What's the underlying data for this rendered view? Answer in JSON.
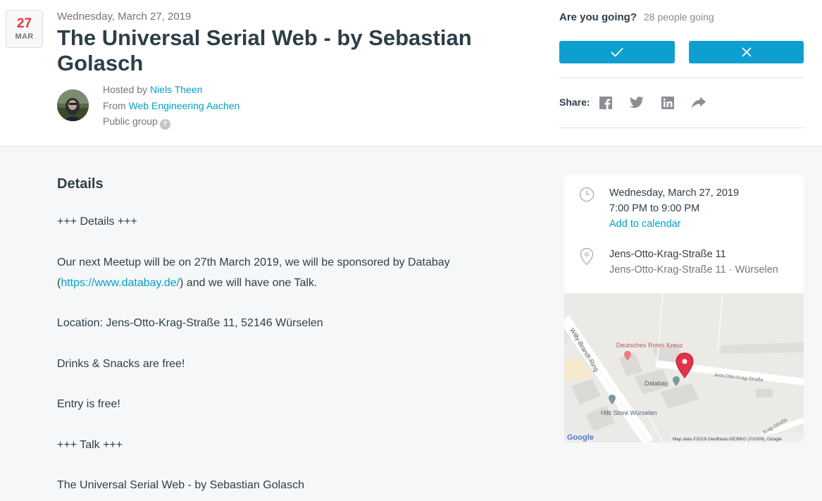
{
  "event": {
    "day": "27",
    "month": "MAR",
    "date_full": "Wednesday, March 27, 2019",
    "title": "The Universal Serial Web - by Sebastian Golasch"
  },
  "host": {
    "hosted_by_prefix": "Hosted by",
    "host_name": "Niels Theen",
    "from_prefix": "From",
    "group_name": "Web Engineering Aachen",
    "group_type": "Public group",
    "help_glyph": "?"
  },
  "rsvp": {
    "question": "Are you going?",
    "attendance": "28 people going"
  },
  "share": {
    "label": "Share:",
    "icons": [
      "facebook-icon",
      "twitter-icon",
      "linkedin-icon",
      "forward-share-icon"
    ]
  },
  "details": {
    "heading": "Details",
    "line_section": "+++ Details +++",
    "line_sponsor_before": "Our next Meetup will be on 27th March 2019, we will be sponsored by Databay (",
    "line_sponsor_link": "https://www.databay.de/",
    "line_sponsor_after": ") and we will have one Talk.",
    "line_location": "Location: Jens-Otto-Krag-Straße 11, 52146 Würselen",
    "line_drinks": "Drinks & Snacks are free!",
    "line_entry": "Entry is free!",
    "line_talk_section": "+++ Talk +++",
    "line_talk_title": "The Universal Serial Web - by Sebastian Golasch"
  },
  "when": {
    "date": "Wednesday, March 27, 2019",
    "time": "7:00 PM to 9:00 PM",
    "add_calendar": "Add to calendar"
  },
  "where": {
    "venue": "Jens-Otto-Krag-Straße 11",
    "address": "Jens-Otto-Krag-Straße 11 · Würselen"
  },
  "map": {
    "street_willy": "Willy-Brandt-Ring",
    "poi_red_cross": "Deutsches Rotes Kreuz",
    "poi_databay": "Databay",
    "street_jens": "Jens-Otto-Krag-Straße",
    "poi_hilti": "Hilti Store Würselen",
    "street_krag": "Krag-Straße",
    "google_logo": "Google",
    "attribution": "Map data ©2019 GeoBasis-DE/BKG (©2009), Google"
  },
  "colors": {
    "accent_blue": "#0e9fd0",
    "link": "#00a2c7",
    "date_red": "#e0393e",
    "text_dark": "#2e3e48",
    "text_muted": "#757575",
    "page_bg": "#f6f7f8",
    "map_pin": "#e2334a"
  }
}
